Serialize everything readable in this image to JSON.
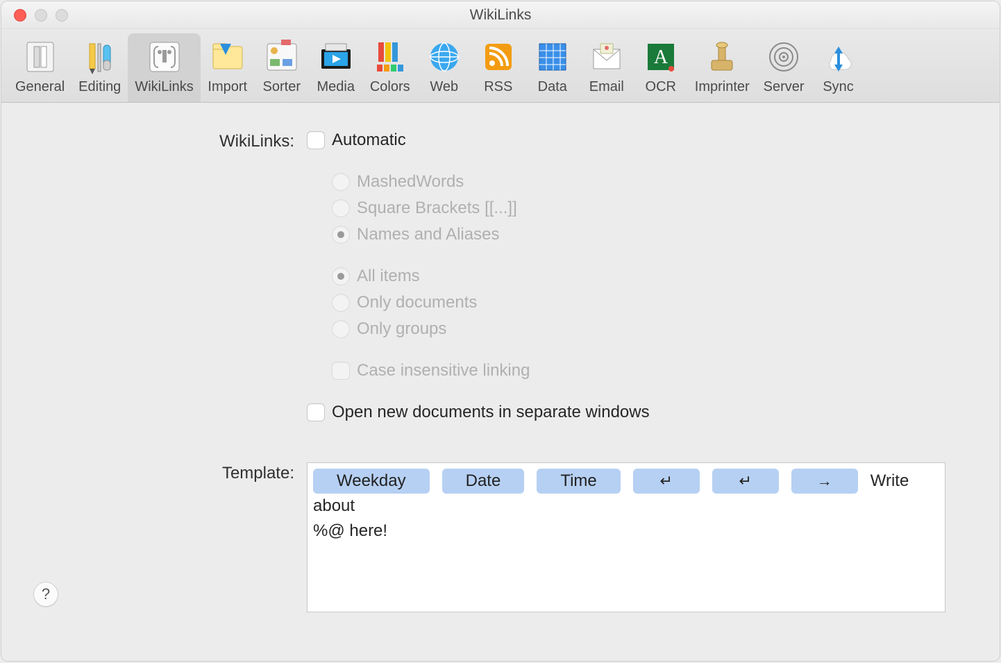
{
  "window": {
    "title": "WikiLinks"
  },
  "toolbar": {
    "items": [
      {
        "id": "general",
        "label": "General"
      },
      {
        "id": "editing",
        "label": "Editing"
      },
      {
        "id": "wikilinks",
        "label": "WikiLinks"
      },
      {
        "id": "import",
        "label": "Import"
      },
      {
        "id": "sorter",
        "label": "Sorter"
      },
      {
        "id": "media",
        "label": "Media"
      },
      {
        "id": "colors",
        "label": "Colors"
      },
      {
        "id": "web",
        "label": "Web"
      },
      {
        "id": "rss",
        "label": "RSS"
      },
      {
        "id": "data",
        "label": "Data"
      },
      {
        "id": "email",
        "label": "Email"
      },
      {
        "id": "ocr",
        "label": "OCR"
      },
      {
        "id": "imprinter",
        "label": "Imprinter"
      },
      {
        "id": "server",
        "label": "Server"
      },
      {
        "id": "sync",
        "label": "Sync"
      }
    ],
    "selected": "wikilinks"
  },
  "form": {
    "section_label": "WikiLinks:",
    "automatic_label": "Automatic",
    "style_options": {
      "mashed": "MashedWords",
      "brackets": "Square Brackets [[...]]",
      "names": "Names and Aliases"
    },
    "scope_options": {
      "all": "All items",
      "docs": "Only documents",
      "grps": "Only groups"
    },
    "case_label": "Case insensitive linking",
    "open_sep_label": "Open new documents in separate windows",
    "template_label": "Template:",
    "template_tokens": {
      "weekday": "Weekday",
      "date": "Date",
      "time": "Time",
      "return": "↵",
      "return2": "↵",
      "tab": "→"
    },
    "template_text_prefix": "Write about",
    "template_text_line2": "%@ here!"
  },
  "help_glyph": "?"
}
